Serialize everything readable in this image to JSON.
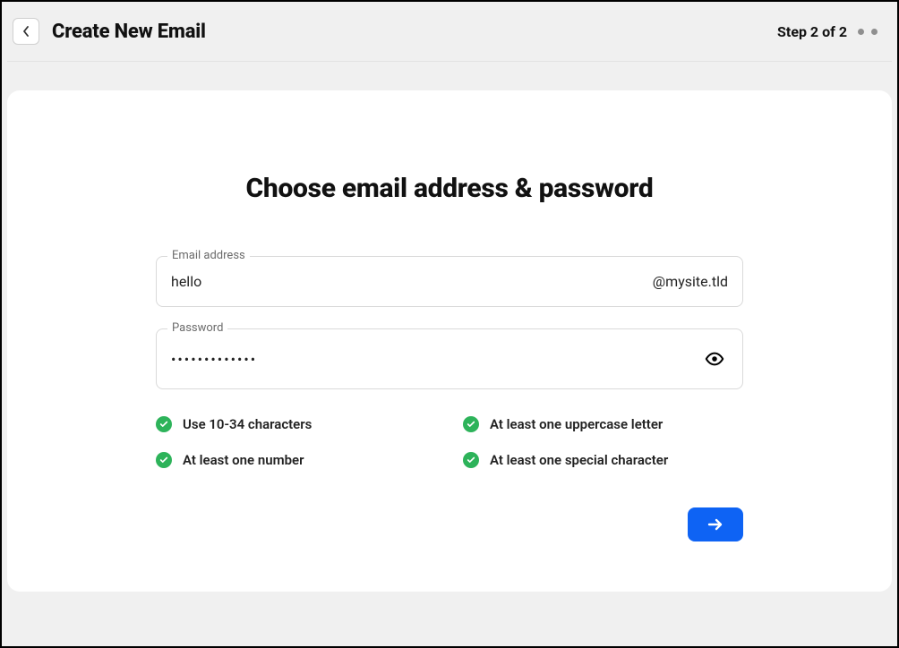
{
  "header": {
    "title": "Create New Email",
    "step_label": "Step 2 of 2"
  },
  "form": {
    "heading": "Choose email address & password",
    "email": {
      "label": "Email address",
      "value": "hello",
      "domain_suffix": "@mysite.tld"
    },
    "password": {
      "label": "Password",
      "value_masked": "•••••••••••••"
    },
    "rules": [
      "Use 10-34 characters",
      "At least one uppercase letter",
      "At least one number",
      "At least one special character"
    ]
  }
}
